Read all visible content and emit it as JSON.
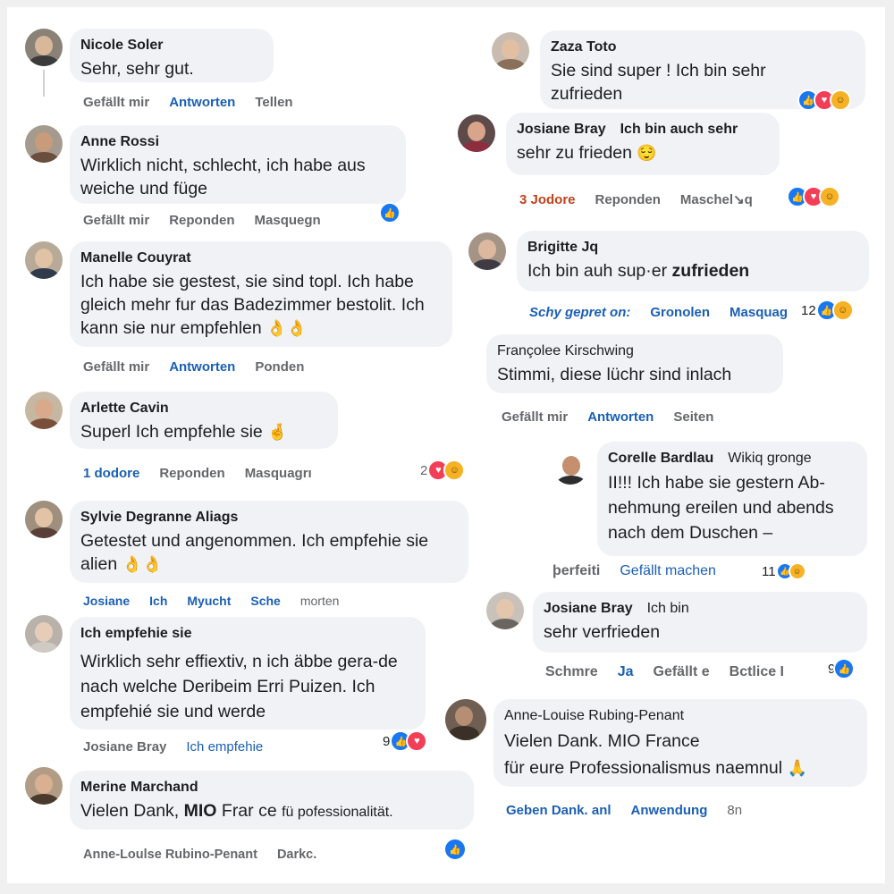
{
  "comments": [
    {
      "name": "Nicole Soler",
      "text": "Sehr, sehr gut.",
      "actions": [
        "Gefällt mir",
        "Antworten",
        "Tellen"
      ]
    },
    {
      "name": "Anne Rossi",
      "text": "Wirklich nicht, schlecht, ich habe aus weiche und füge",
      "actions": [
        "Gefällt mir",
        "Reponden",
        "Masquegn"
      ]
    },
    {
      "name": "Manelle Couyrat",
      "text": "Ich habe sie gestest, sie sind topl. Ich habe gleich mehr fur das Badezimmer bestolit. Ich kann sie nur empfehlen",
      "emoji": "👌👌",
      "actions": [
        "Gefällt mir",
        "Antworten",
        "Ponden"
      ]
    },
    {
      "name": "Arlette Cavin",
      "text": "Superl Ich empfehle sie",
      "emoji": "🤞",
      "actions": [
        "1 dodore",
        "Reponden",
        "Masquagrı"
      ],
      "count": "2"
    },
    {
      "name": "Sylvie Degranne Aliags",
      "text": "Getestet und angenommen. Ich empfehie sie alien",
      "emoji": "👌👌",
      "actions": [
        "Josiane",
        "Ich",
        "Myucht",
        "Sche",
        "morten"
      ]
    },
    {
      "name": "Ich empfehie sie",
      "text": "Wirklich sehr effiextiv, n ich äbbe gera-de nach welche Deribeim Erri Puizen. Ich empfehié sie und werde",
      "actions": [
        "Josiane Bray",
        "Ich empfehie"
      ],
      "count": "9"
    },
    {
      "name": "Merine Marchand",
      "text_a": "Vielen Dank,",
      "text_b": "MIO",
      "text_c": "Frar ce",
      "text_d": "fü pofessionalität.",
      "actions": [
        "Anne-Loulse Rubino-Penant",
        "Darkc."
      ]
    },
    {
      "name": "Zaza Toto",
      "text": "Sie sind super ! Ich bin sehr zufrieden"
    },
    {
      "name": "Josiane Bray",
      "name_extra": "Ich bin auch sehr",
      "text": "sehr zu frieden",
      "emoji": "😌",
      "actions": [
        "3 Jodore",
        "Reponden",
        "Maschel↘q"
      ]
    },
    {
      "name": "Brigitte Jq",
      "text_a": "Ich bin auh sup·er",
      "text_b": "zufrieden",
      "actions": [
        "Schy gepret on:",
        "Gronolen",
        "Masquag"
      ],
      "count": "12"
    },
    {
      "name": "Françolee Kirschwing",
      "text": "Stimmi, diese lüchr sind inlach",
      "actions": [
        "Gefällt mir",
        "Antworten",
        "Seiten"
      ]
    },
    {
      "name": "Corelle Bardlau",
      "name_extra": "Wikiq gronge",
      "text": "II!!! Ich habe sie gestern Ab-nehmung ereilen und abends nach dem Duschen –",
      "actions": [
        "þerfeiti",
        "Gefällt machen"
      ],
      "count": "11"
    },
    {
      "name": "Josiane Bray",
      "name_extra": "Ich bin",
      "text": "sehr verfrieden",
      "actions": [
        "Schmre",
        "Ja",
        "Gefällt e",
        "Bctlice I"
      ],
      "count": "9"
    },
    {
      "name": "Anne-Louise Rubing-Penant",
      "text_a": "Vielen Dank. MIO France",
      "text_b": "für eure Professionalismus naemnul",
      "emoji": "🙏",
      "actions": [
        "Geben Dank. anl",
        "Anwendung",
        "8n"
      ]
    }
  ],
  "colors": {
    "like": "#1877f2",
    "love": "#f33e58",
    "haha": "#f7b125",
    "bubble": "#f0f2f5",
    "link": "#1b5fb4"
  },
  "icons": {
    "like": "like-icon",
    "love": "love-icon",
    "haha": "haha-icon"
  }
}
